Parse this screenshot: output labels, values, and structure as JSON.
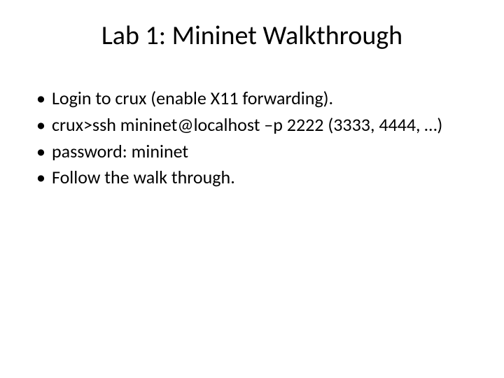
{
  "slide": {
    "title": "Lab 1: Mininet Walkthrough",
    "bullets": [
      "Login to crux (enable X11 forwarding).",
      "crux>ssh mininet@localhost –p 2222 (3333, 4444, …)",
      "password: mininet",
      "Follow the walk through."
    ]
  }
}
